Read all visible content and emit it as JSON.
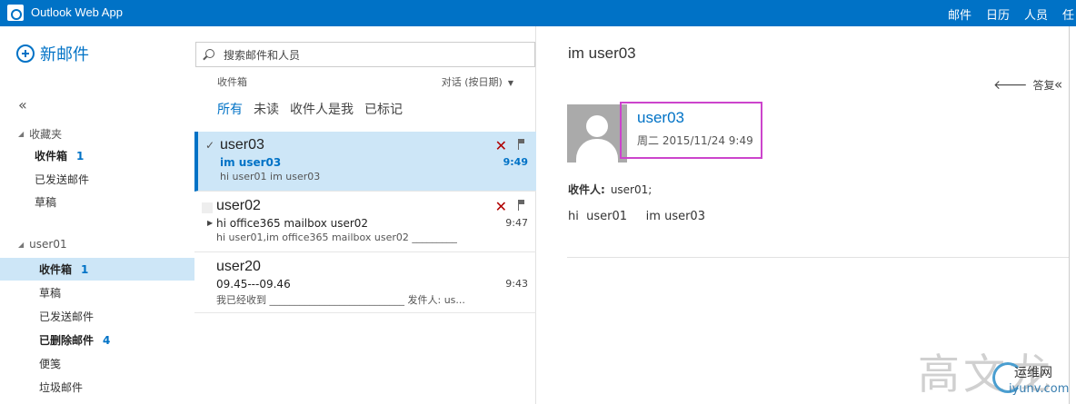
{
  "app": {
    "title": "Outlook Web App"
  },
  "nav": [
    "邮件",
    "日历",
    "人员",
    "任"
  ],
  "left": {
    "new_mail": "新邮件",
    "collapse_glyph": "«",
    "favorites_header": "收藏夹",
    "favorites": [
      {
        "label": "收件箱",
        "count": "1"
      },
      {
        "label": "已发送邮件",
        "count": ""
      },
      {
        "label": "草稿",
        "count": ""
      }
    ],
    "account_header": "user01",
    "folders": [
      {
        "label": "收件箱",
        "count": "1"
      },
      {
        "label": "草稿",
        "count": ""
      },
      {
        "label": "已发送邮件",
        "count": ""
      },
      {
        "label": "已删除邮件",
        "count": "4"
      },
      {
        "label": "便笺",
        "count": ""
      },
      {
        "label": "垃圾邮件",
        "count": ""
      }
    ]
  },
  "middle": {
    "search_placeholder": "搜索邮件和人员",
    "inbox_label": "收件箱",
    "sort_label": "对话 (按日期)",
    "filters": [
      "所有",
      "未读",
      "收件人是我",
      "已标记"
    ],
    "messages": [
      {
        "sender": "user03",
        "subject": "im user03",
        "preview": "hi user01 im user03",
        "time": "9:49"
      },
      {
        "sender": "user02",
        "subject": "hi office365 mailbox user02",
        "preview": "hi  user01,im office365 mailbox user02   _________",
        "time": "9:47"
      },
      {
        "sender": "user20",
        "subject": "09.45---09.46",
        "preview": "我已经收到    ___________________________  发件人: us...",
        "time": "9:43"
      }
    ]
  },
  "reading": {
    "subject": "im user03",
    "reply_label": "答复",
    "sender": "user03",
    "date": "周二 2015/11/24 9:49",
    "to_label": "收件人:",
    "to_value": "user01;",
    "body": "hi  user01     im user03"
  },
  "watermark": {
    "big": "高文龙",
    "cn": "运维网",
    "url": "iyunv.com"
  }
}
